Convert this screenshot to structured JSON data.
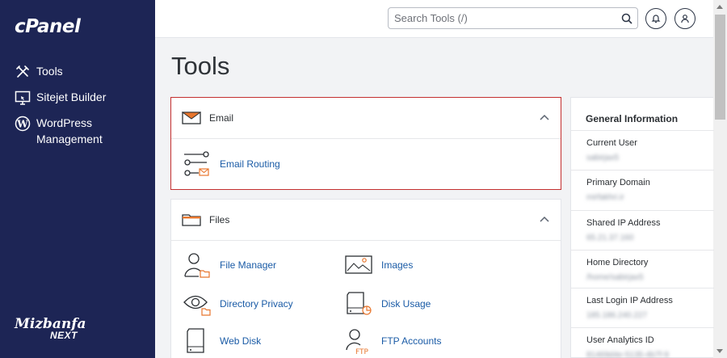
{
  "sidebar": {
    "logo": "cPanel",
    "items": [
      {
        "label": "Tools",
        "icon": "tools-icon"
      },
      {
        "label": "Sitejet Builder",
        "icon": "monitor-icon"
      },
      {
        "label": "WordPress Management",
        "icon": "wordpress-icon"
      }
    ],
    "brand_line1": "Mizbanfa",
    "brand_line2": "NEXT"
  },
  "header": {
    "search_placeholder": "Search Tools (/)"
  },
  "main": {
    "title": "Tools",
    "sections": [
      {
        "title": "Email",
        "tools": [
          "Email Routing"
        ]
      },
      {
        "title": "Files",
        "tools": [
          "File Manager",
          "Images",
          "Directory Privacy",
          "Disk Usage",
          "Web Disk",
          "FTP Accounts"
        ]
      }
    ]
  },
  "general_info": {
    "title": "General Information",
    "rows": [
      {
        "label": "Current User",
        "value": "sabirjax5"
      },
      {
        "label": "Primary Domain",
        "value": "mirfakhri.ir"
      },
      {
        "label": "Shared IP Address",
        "value": "65.21.37.160"
      },
      {
        "label": "Home Directory",
        "value": "/home/sabirjax5"
      },
      {
        "label": "Last Login IP Address",
        "value": "185.186.240.227"
      },
      {
        "label": "User Analytics ID",
        "value": "81469d4e-5135-4b7f-9"
      }
    ]
  },
  "colors": {
    "sidebar_bg": "#1d2555",
    "link": "#1a5ba6",
    "highlight_border": "#c42f2f",
    "icon_accent": "#e8762d"
  }
}
